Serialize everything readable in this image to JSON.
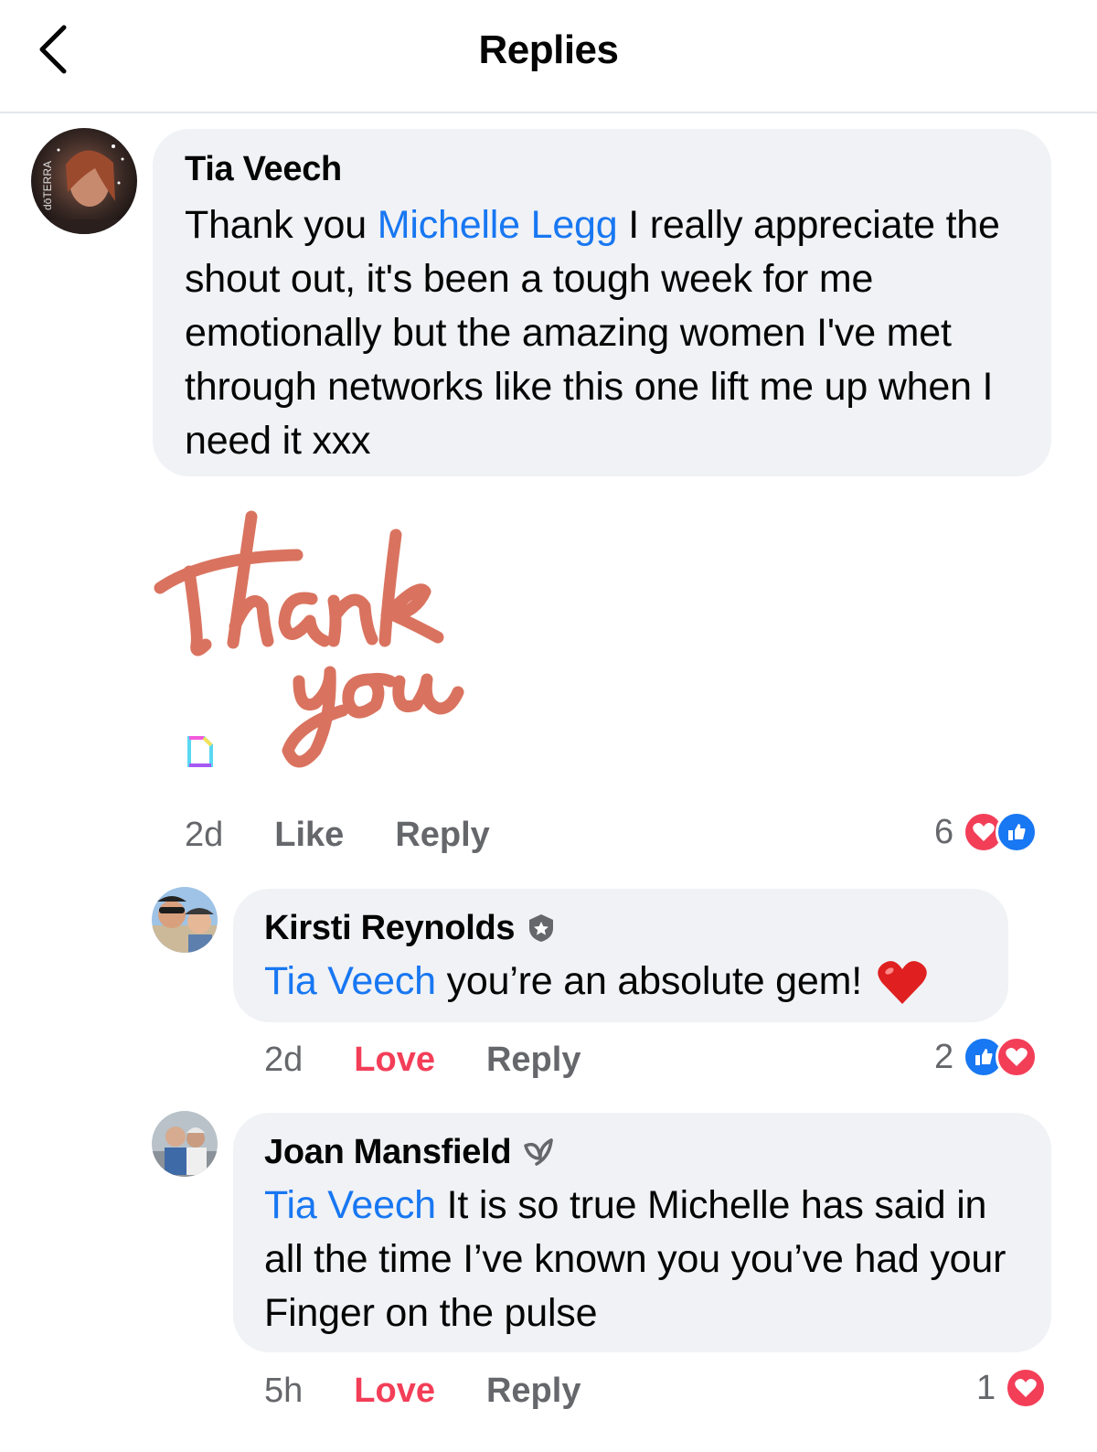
{
  "header": {
    "title": "Replies",
    "back_icon": "chevron-left-icon"
  },
  "comments": [
    {
      "author": "Tia Veech",
      "mention": "Michelle Legg",
      "text_before": "Thank you ",
      "text_after": " I really appreciate the shout out, it's been a tough week for me emotionally but the amazing women I've met through networks like this one lift me up when I need it xxx",
      "sticker_text": "thank you",
      "time": "2d",
      "action_react": "Like",
      "action_reply": "Reply",
      "reaction_count": "6",
      "reactions": [
        "heart",
        "like"
      ],
      "avatar_text": "dōTERRA"
    },
    {
      "author": "Kirsti Reynolds",
      "badge": "shield-badge-icon",
      "mention": "Tia Veech",
      "text": " you’re an absolute gem! ",
      "emoji": "❤️",
      "time": "2d",
      "action_react": "Love",
      "action_reply": "Reply",
      "reaction_count": "2",
      "reactions": [
        "like",
        "heart"
      ]
    },
    {
      "author": "Joan Mansfield",
      "badge": "leaf-badge-icon",
      "mention": "Tia Veech",
      "text": " It is so true Michelle has said in all the time I’ve known you you’ve had your Finger on the pulse",
      "time": "5h",
      "action_react": "Love",
      "action_reply": "Reply",
      "reaction_count": "1",
      "reactions": [
        "heart"
      ]
    }
  ],
  "colors": {
    "mention": "#1877f2",
    "love": "#f33e58",
    "bubble": "#f0f2f5",
    "sticker": "#d9735f"
  }
}
